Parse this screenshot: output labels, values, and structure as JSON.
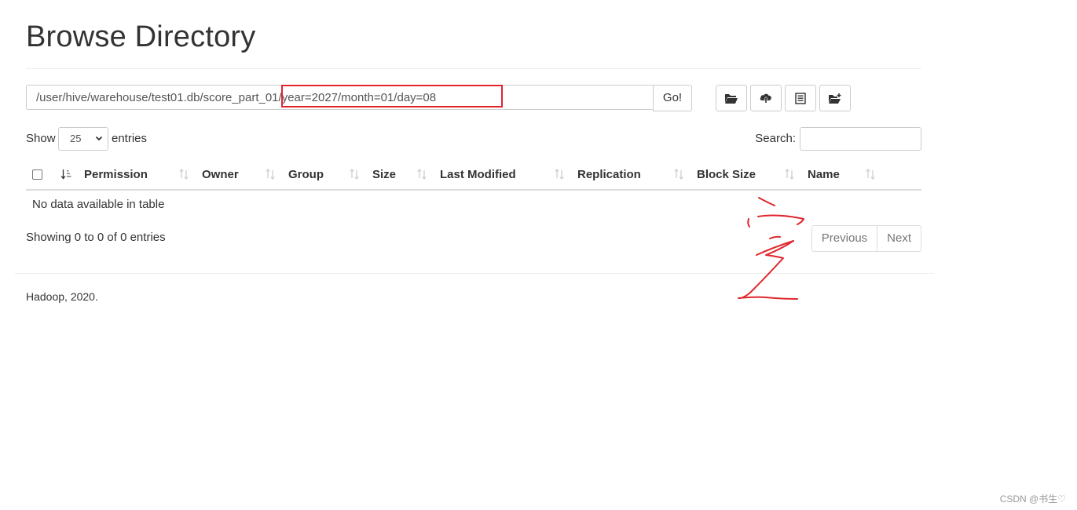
{
  "header": {
    "title": "Browse Directory"
  },
  "path_bar": {
    "value": "/user/hive/warehouse/test01.db/score_part_01/year=2027/month=01/day=08",
    "go_label": "Go!",
    "tools": [
      {
        "icon": "folder-open-icon"
      },
      {
        "icon": "cloud-upload-icon"
      },
      {
        "icon": "list-icon"
      },
      {
        "icon": "folder-plus-icon"
      }
    ],
    "highlight_color": "#e0262c"
  },
  "length_control": {
    "prefix": "Show",
    "selected": "25",
    "suffix": "entries"
  },
  "search": {
    "label": "Search:",
    "value": ""
  },
  "table": {
    "columns": [
      "Permission",
      "Owner",
      "Group",
      "Size",
      "Last Modified",
      "Replication",
      "Block Size",
      "Name"
    ],
    "empty_message": "No data available in table"
  },
  "info": {
    "text": "Showing 0 to 0 of 0 entries"
  },
  "pagination": {
    "previous": "Previous",
    "next": "Next"
  },
  "footer": {
    "text": "Hadoop, 2020."
  },
  "watermark": {
    "text": "CSDN @书生♡"
  },
  "annotation": {
    "color": "#e0262c"
  }
}
